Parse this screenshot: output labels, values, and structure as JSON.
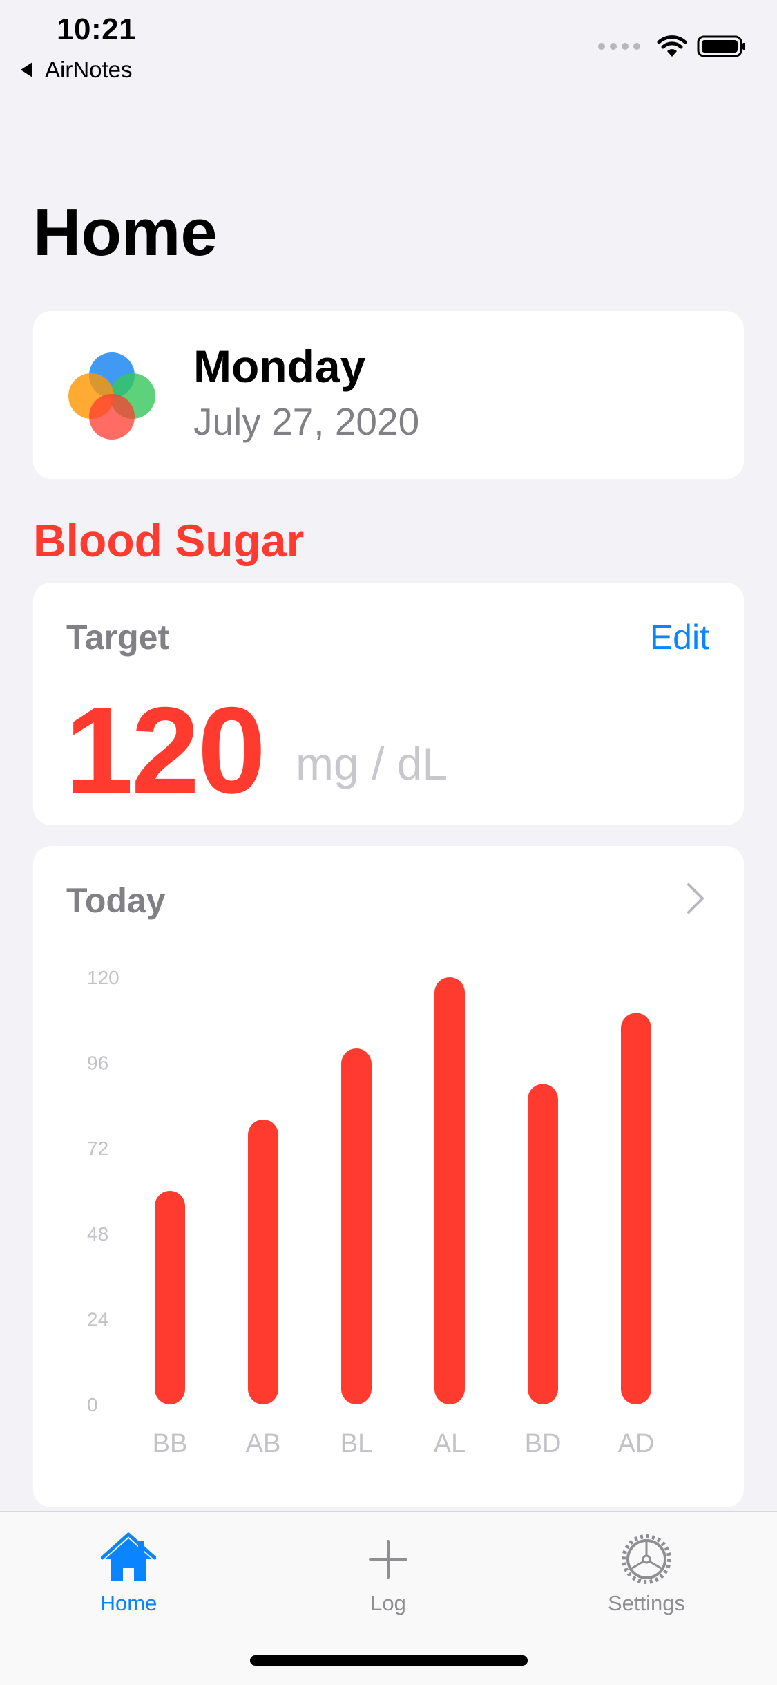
{
  "status_bar": {
    "time": "10:21",
    "back_app": "AirNotes",
    "icons": [
      "signal-dots-icon",
      "wifi-icon",
      "battery-icon"
    ]
  },
  "page": {
    "title": "Home"
  },
  "date_card": {
    "logo": "app-logo-circles",
    "day": "Monday",
    "date": "July 27, 2020"
  },
  "blood_sugar": {
    "section_title": "Blood Sugar",
    "target": {
      "heading": "Target",
      "edit_label": "Edit",
      "value": "120",
      "unit": "mg / dL"
    },
    "today": {
      "heading": "Today",
      "chevron_icon": "chevron-right-icon"
    }
  },
  "chart_data": {
    "type": "bar",
    "categories": [
      "BB",
      "AB",
      "BL",
      "AL",
      "BD",
      "AD"
    ],
    "values": [
      60,
      80,
      100,
      120,
      90,
      110
    ],
    "y_ticks": [
      "120",
      "96",
      "72",
      "48",
      "24",
      "0"
    ],
    "ylim": [
      0,
      120
    ],
    "bar_color": "#ff3b30",
    "title": "",
    "xlabel": "",
    "ylabel": "",
    "grid": false
  },
  "tab_bar": {
    "tabs": [
      {
        "label": "Home",
        "icon": "house-icon",
        "active": true
      },
      {
        "label": "Log",
        "icon": "plus-icon",
        "active": false
      },
      {
        "label": "Settings",
        "icon": "gear-icon",
        "active": false
      }
    ]
  },
  "colors": {
    "accent": "#0a84ff",
    "brand_red": "#ff3b30",
    "background": "#f2f2f7"
  }
}
